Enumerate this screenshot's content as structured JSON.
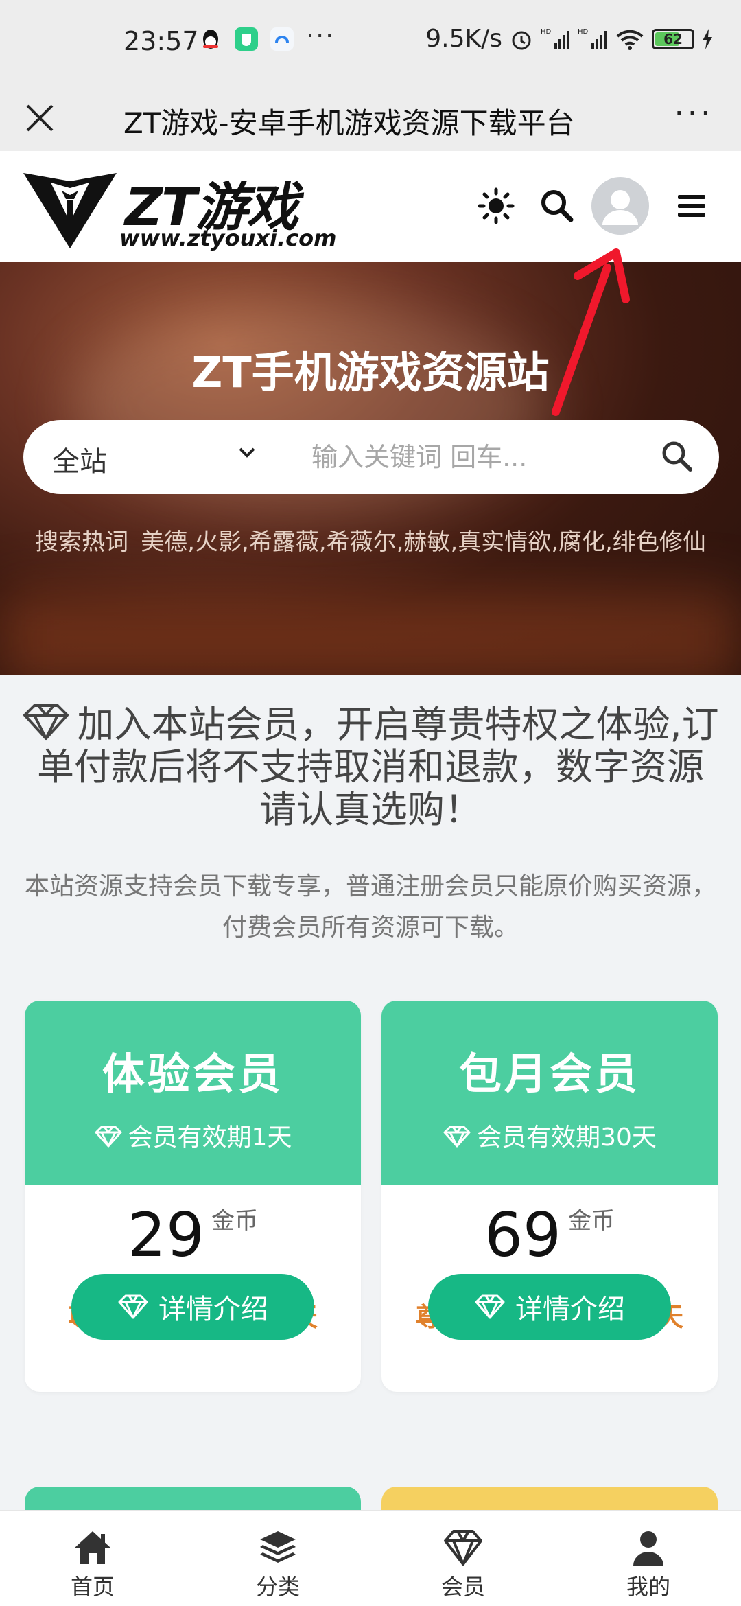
{
  "status_bar": {
    "time": "23:57",
    "more": "···",
    "net_speed": "9.5K/s",
    "battery": "62"
  },
  "browser": {
    "title": "ZT游戏-安卓手机游戏资源下载平台",
    "more": "···"
  },
  "header": {
    "logo_text": "ZT游戏",
    "logo_url": "www.ztyouxi.com"
  },
  "hero": {
    "title": "ZT手机游戏资源站",
    "search_scope": "全站",
    "search_placeholder": "输入关键词 回车...",
    "hot_label": "搜索热词",
    "hot_words": "美德,火影,希露薇,希薇尔,赫敏,真实情欲,腐化,绯色修仙"
  },
  "membership": {
    "title": "加入本站会员，开启尊贵特权之体验,订单付款后将不支持取消和退款，数字资源请认真选购！",
    "description": "本站资源支持会员下载专享，普通注册会员只能原价购买资源，付费会员所有资源可下载。",
    "plans": [
      {
        "name": "体验会员",
        "validity": "会员有效期1天",
        "price": "29",
        "unit": "金币",
        "perk": "尊享VIP会员特权1天",
        "button": "详情介绍"
      },
      {
        "name": "包月会员",
        "validity": "会员有效期30天",
        "price": "69",
        "unit": "金币",
        "perk": "尊享VIP会员特权30天",
        "button": "详情介绍"
      }
    ]
  },
  "tabbar": {
    "items": [
      {
        "label": "首页",
        "icon": "home-icon"
      },
      {
        "label": "分类",
        "icon": "layers-icon"
      },
      {
        "label": "会员",
        "icon": "diamond-icon"
      },
      {
        "label": "我的",
        "icon": "user-icon"
      }
    ]
  },
  "colors": {
    "card_header": "#4cce a0",
    "button": "#17b885",
    "perk_text": "#e0812c",
    "annotation": "#f0182c"
  }
}
